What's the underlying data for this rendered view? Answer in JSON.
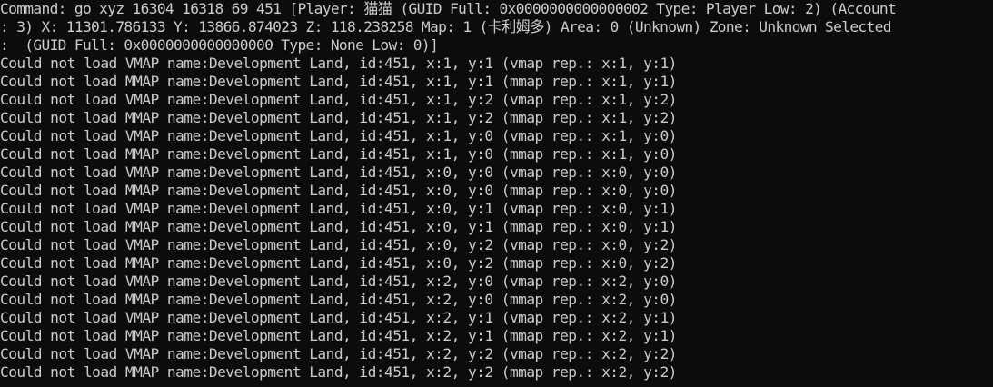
{
  "console": {
    "header_lines": [
      "Command: go xyz 16304 16318 69 451 [Player: 猫猫 (GUID Full: 0x0000000000000002 Type: Player Low: 2) (Account",
      ": 3) X: 11301.786133 Y: 13866.874023 Z: 118.238258 Map: 1 (卡利姆多) Area: 0 (Unknown) Zone: Unknown Selected",
      ":  (GUID Full: 0x0000000000000000 Type: None Low: 0)]"
    ],
    "log_lines": [
      "Could not load VMAP name:Development Land, id:451, x:1, y:1 (vmap rep.: x:1, y:1)",
      "Could not load MMAP name:Development Land, id:451, x:1, y:1 (mmap rep.: x:1, y:1)",
      "Could not load VMAP name:Development Land, id:451, x:1, y:2 (vmap rep.: x:1, y:2)",
      "Could not load MMAP name:Development Land, id:451, x:1, y:2 (mmap rep.: x:1, y:2)",
      "Could not load VMAP name:Development Land, id:451, x:1, y:0 (vmap rep.: x:1, y:0)",
      "Could not load MMAP name:Development Land, id:451, x:1, y:0 (mmap rep.: x:1, y:0)",
      "Could not load VMAP name:Development Land, id:451, x:0, y:0 (vmap rep.: x:0, y:0)",
      "Could not load MMAP name:Development Land, id:451, x:0, y:0 (mmap rep.: x:0, y:0)",
      "Could not load VMAP name:Development Land, id:451, x:0, y:1 (vmap rep.: x:0, y:1)",
      "Could not load MMAP name:Development Land, id:451, x:0, y:1 (mmap rep.: x:0, y:1)",
      "Could not load VMAP name:Development Land, id:451, x:0, y:2 (vmap rep.: x:0, y:2)",
      "Could not load MMAP name:Development Land, id:451, x:0, y:2 (mmap rep.: x:0, y:2)",
      "Could not load VMAP name:Development Land, id:451, x:2, y:0 (vmap rep.: x:2, y:0)",
      "Could not load MMAP name:Development Land, id:451, x:2, y:0 (mmap rep.: x:2, y:0)",
      "Could not load VMAP name:Development Land, id:451, x:2, y:1 (vmap rep.: x:2, y:1)",
      "Could not load MMAP name:Development Land, id:451, x:2, y:1 (mmap rep.: x:2, y:1)",
      "Could not load VMAP name:Development Land, id:451, x:2, y:2 (vmap rep.: x:2, y:2)",
      "Could not load MMAP name:Development Land, id:451, x:2, y:2 (mmap rep.: x:2, y:2)"
    ]
  },
  "colors": {
    "background": "#0c0c0c",
    "text": "#cccccc"
  }
}
